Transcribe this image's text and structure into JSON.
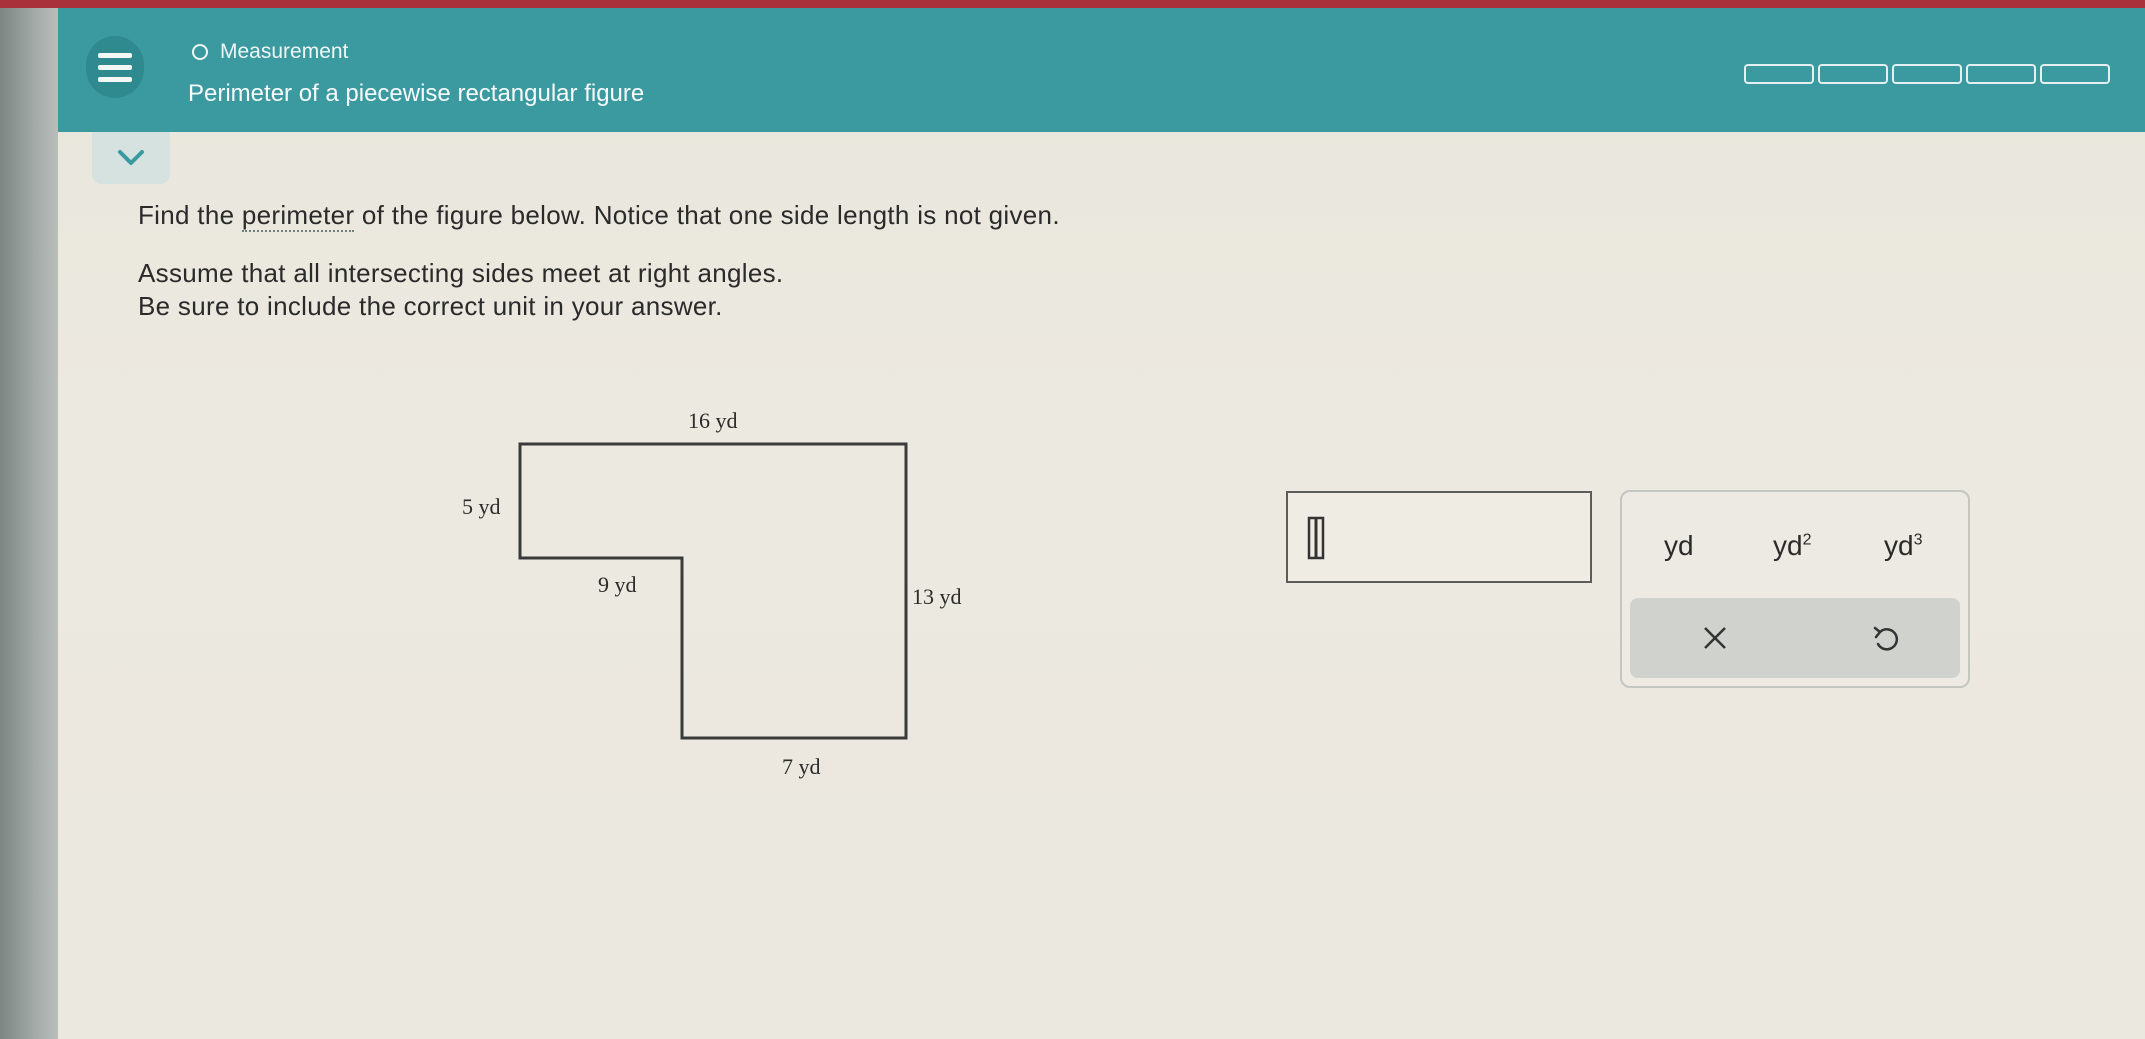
{
  "header": {
    "topic": "Measurement",
    "title": "Perimeter of a piecewise rectangular figure",
    "progress_segments": 5
  },
  "question": {
    "line1_before": "Find the ",
    "line1_link": "perimeter",
    "line1_after": " of the figure below. Notice that one side length is not given.",
    "line2": "Assume that all intersecting sides meet at right angles.",
    "line3": "Be sure to include the correct unit in your answer."
  },
  "figure": {
    "top": "16 yd",
    "left": "5 yd",
    "inner_horizontal": "9 yd",
    "right": "13 yd",
    "bottom": "7 yd"
  },
  "answer": {
    "value": ""
  },
  "keypad": {
    "unit1": "yd",
    "unit2_base": "yd",
    "unit2_exp": "2",
    "unit3_base": "yd",
    "unit3_exp": "3",
    "clear_icon": "x-icon",
    "undo_icon": "undo-icon"
  },
  "colors": {
    "header": "#3b9aa0",
    "top_strip": "#a8313b",
    "background": "#ebe8df"
  }
}
